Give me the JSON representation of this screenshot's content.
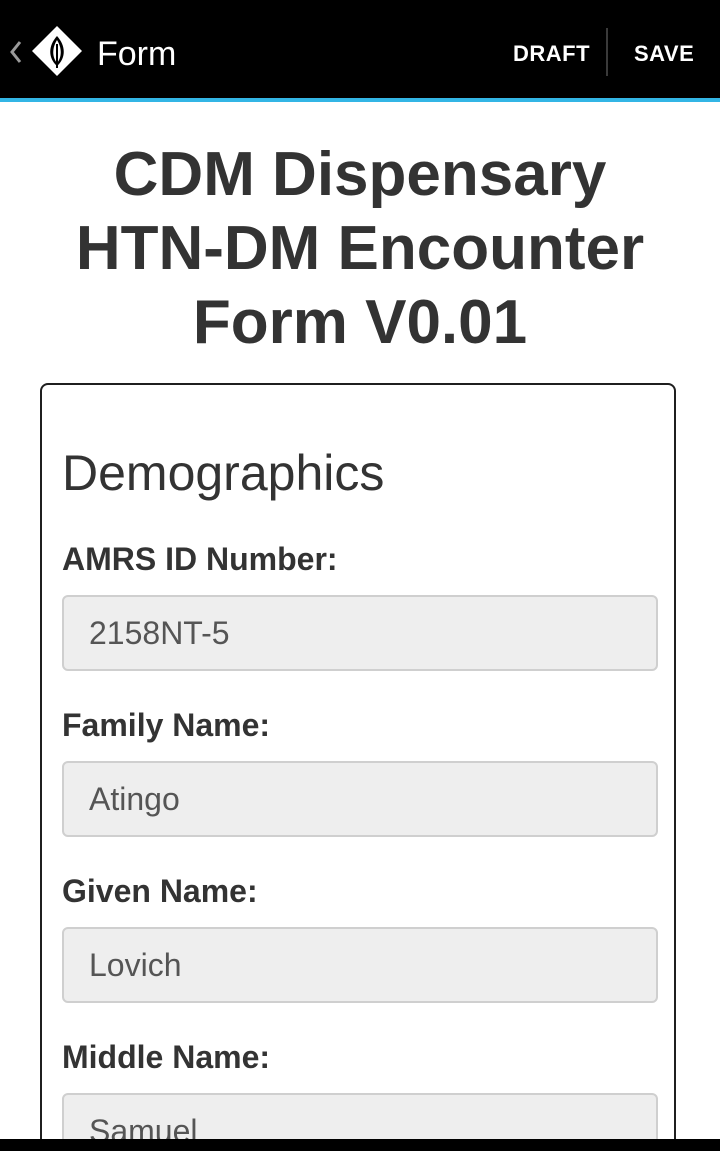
{
  "actionbar": {
    "back_icon": "chevron-left-icon",
    "logo_icon": "leaf-diamond-logo-icon",
    "title": "Form",
    "draft_label": "DRAFT",
    "save_label": "SAVE",
    "accent_color": "#33b5e5"
  },
  "form": {
    "title_line1": "CDM Dispensary",
    "title_line2": "HTN-DM Encounter",
    "title_line3": "Form V0.01"
  },
  "section": {
    "title": "Demographics",
    "fields": [
      {
        "label": "AMRS ID Number:",
        "value": "2158NT-5"
      },
      {
        "label": "Family Name:",
        "value": "Atingo"
      },
      {
        "label": "Given Name:",
        "value": "Lovich"
      },
      {
        "label": "Middle Name:",
        "value": "Samuel"
      }
    ]
  }
}
